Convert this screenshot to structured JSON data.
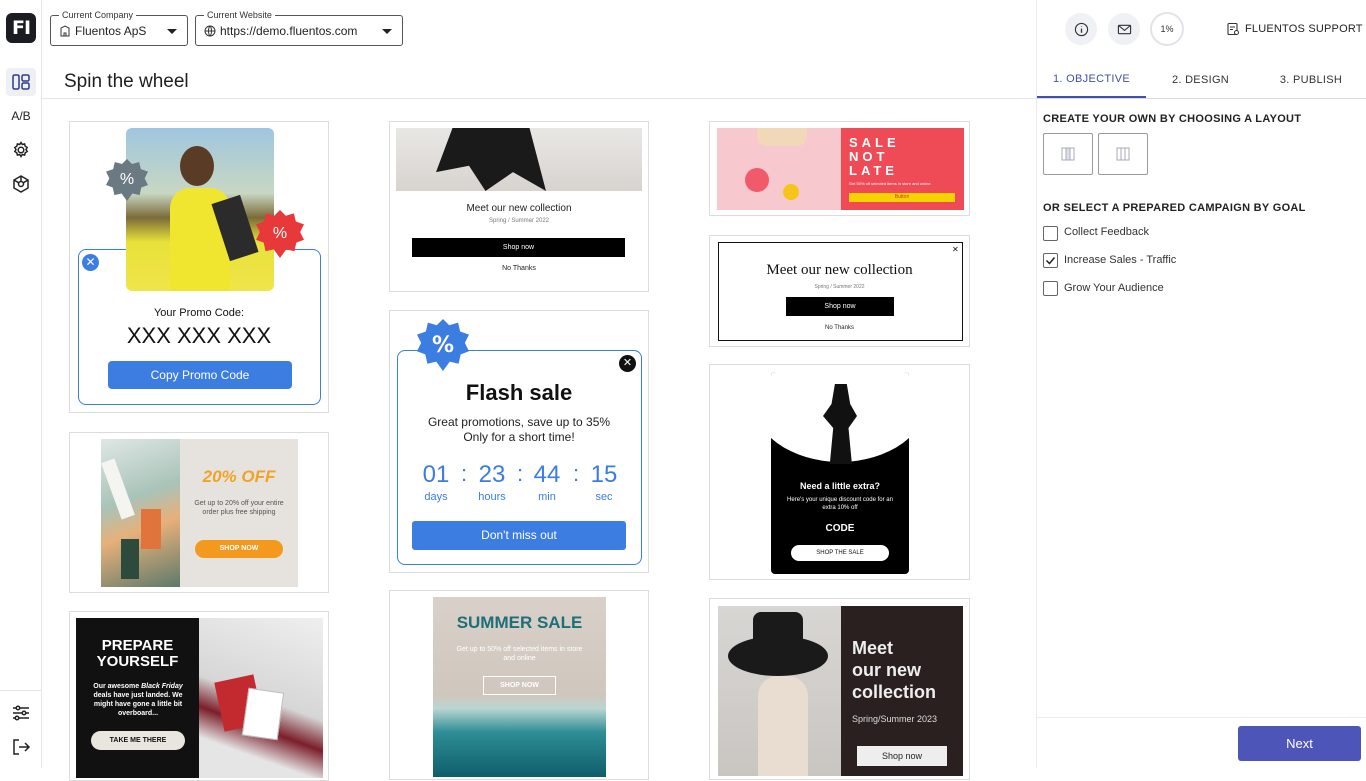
{
  "brand": {
    "logo_text": "FI",
    "accent": "#4e55b8",
    "primary_blue": "#3b7de1"
  },
  "rail": {
    "items": [
      {
        "name": "layouts-icon"
      },
      {
        "name": "ab-test",
        "label": "A/B"
      },
      {
        "name": "gear-icon"
      },
      {
        "name": "integrations-icon"
      }
    ],
    "bottom": [
      {
        "name": "sliders-icon"
      },
      {
        "name": "logout-icon"
      }
    ]
  },
  "header": {
    "company": {
      "label": "Current Company",
      "value": "Fluentos ApS"
    },
    "website": {
      "label": "Current Website",
      "value": "https://demo.fluentos.com"
    }
  },
  "page": {
    "title": "Spin the wheel"
  },
  "templates": {
    "promo": {
      "label": "Your Promo Code:",
      "code": "XXX XXX XXX",
      "button": "Copy Promo Code",
      "badge": "%"
    },
    "collection1": {
      "heading": "Meet our new collection",
      "sub": "Spring / Summer 2022",
      "button": "Shop now",
      "dismiss": "No Thanks"
    },
    "sale_not_late": {
      "line1": "SALE",
      "line2": "NOT",
      "line3": "LATE",
      "sub": "Get 50% off selected items in store and online.",
      "button": "Button"
    },
    "collection2": {
      "heading": "Meet our new collection",
      "sub": "Spring / Summer 2022",
      "button": "Shop now",
      "dismiss": "No Thanks"
    },
    "twenty_off": {
      "heading": "20% OFF",
      "body": "Get up to 20% off your entire order plus free shipping",
      "button": "SHOP NOW"
    },
    "flash": {
      "title": "Flash sale",
      "body1": "Great promotions, save up to 35%",
      "body2": "Only for a short time!",
      "days": "01",
      "hours": "23",
      "min": "44",
      "sec": "15",
      "days_l": "days",
      "hours_l": "hours",
      "min_l": "min",
      "sec_l": "sec",
      "button": "Don't miss out",
      "badge": "%"
    },
    "extra": {
      "heading": "Need a little extra?",
      "body": "Here's your unique discount code for an extra 10% off",
      "code": "CODE",
      "button": "SHOP THE SALE"
    },
    "prepare": {
      "line1": "PREPARE",
      "line2": "YOURSELF",
      "body_pre": "Our awesome ",
      "body_em": "Black Friday",
      "body_post": " deals have just landed. We might have gone a little bit overboard...",
      "button": "TAKE ME THERE"
    },
    "summer": {
      "heading": "SUMMER SALE",
      "body": "Get up to 50% off selected items in store and online",
      "button": "SHOP NOW"
    },
    "collection3": {
      "line1": "Meet",
      "line2": "our new",
      "line3": "collection",
      "sub": "Spring/Summer 2023",
      "button": "Shop now"
    }
  },
  "panel": {
    "progress": "1%",
    "support": "FLUENTOS SUPPORT",
    "tabs": [
      "1. OBJECTIVE",
      "2. DESIGN",
      "3. PUBLISH"
    ],
    "layout_heading": "CREATE YOUR OWN BY CHOOSING A LAYOUT",
    "goal_heading": "OR SELECT A PREPARED CAMPAIGN BY GOAL",
    "goals": [
      {
        "label": "Collect Feedback",
        "checked": false
      },
      {
        "label": "Increase Sales - Traffic",
        "checked": true
      },
      {
        "label": "Grow Your Audience",
        "checked": false
      }
    ],
    "next": "Next"
  }
}
